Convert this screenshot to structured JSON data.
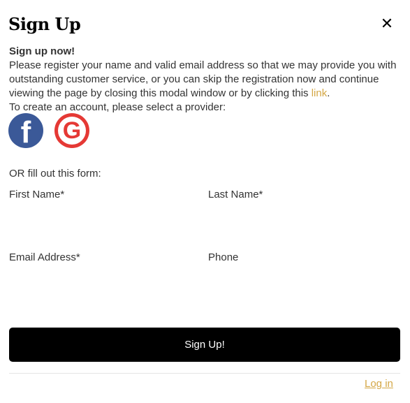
{
  "modal": {
    "title": "Sign Up",
    "close_symbol": "✕",
    "close_icon": "close-icon",
    "intro": {
      "heading": "Sign up now!",
      "text_before_link": "Please register your name and valid email address so that we may provide you with outstanding customer service, or you can skip the registration now and continue viewing the page by closing this modal window or by clicking this ",
      "link_text": "link",
      "text_after_link": ".",
      "provider_prompt": "To create an account, please select a provider:"
    },
    "providers": [
      {
        "name": "facebook",
        "icon": "facebook-icon",
        "glyph": "f",
        "color": "#3b5998"
      },
      {
        "name": "google",
        "icon": "google-icon",
        "glyph": "G",
        "color": "#e53935"
      }
    ],
    "or_text": "OR fill out this form:",
    "form": {
      "first_name_label": "First Name*",
      "first_name_value": "",
      "last_name_label": "Last Name*",
      "last_name_value": "",
      "email_label": "Email Address*",
      "email_value": "",
      "phone_label": "Phone",
      "phone_value": ""
    },
    "submit_label": "Sign Up!",
    "login_label": "Log in",
    "colors": {
      "accent": "#d4a745",
      "button": "#000000",
      "text": "#333333"
    }
  }
}
